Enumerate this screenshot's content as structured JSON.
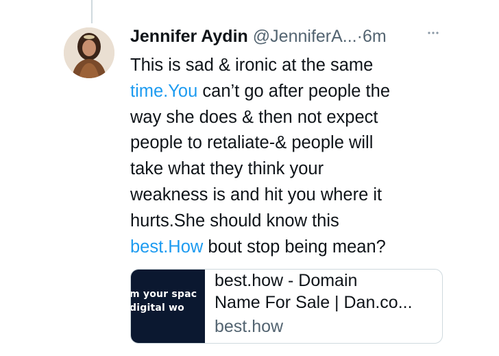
{
  "tweet": {
    "author_name": "Jennifer Aydin",
    "handle": "@JenniferA...",
    "separator": "·",
    "time": "6m",
    "more_icon": "ellipsis-icon",
    "text_lines": [
      {
        "pre": "This is sad & ironic at the same",
        "link": "",
        "post": ""
      },
      {
        "pre": "",
        "link": "time.You",
        "post": " can’t go after people the"
      },
      {
        "pre": "way she does & then not expect",
        "link": "",
        "post": ""
      },
      {
        "pre": "people to retaliate-& people will",
        "link": "",
        "post": ""
      },
      {
        "pre": "take what they think your",
        "link": "",
        "post": ""
      },
      {
        "pre": "weakness is and hit you where it",
        "link": "",
        "post": ""
      },
      {
        "pre": "hurts.She should know this",
        "link": "",
        "post": ""
      },
      {
        "pre": "",
        "link": "best.How",
        "post": " bout stop being mean?"
      }
    ],
    "link_color": "#1d9bf0"
  },
  "card": {
    "thumb_text_line1": "m your spac",
    "thumb_text_line2": "digital wo",
    "title_line1": "best.how - Domain",
    "title_line2": "Name For Sale | Dan.co...",
    "domain": "best.how"
  }
}
